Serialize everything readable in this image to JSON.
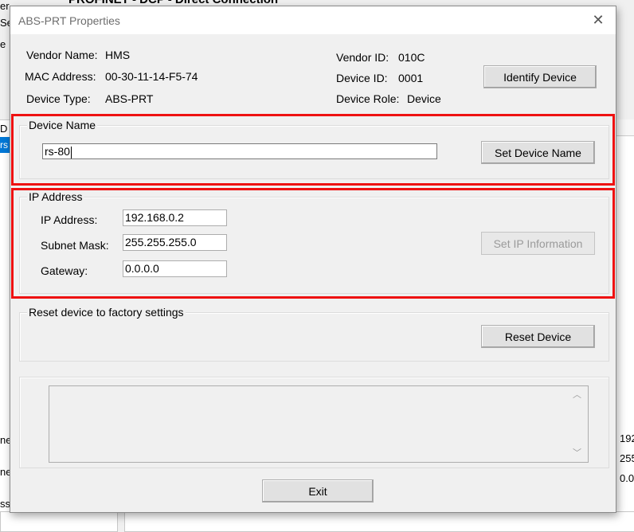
{
  "background": {
    "title_fragment": "PROFINET - DCP - Direct Connection",
    "left_fragments": [
      "er",
      "Se",
      "e",
      "D",
      "rs",
      "ne",
      "ne",
      "ss"
    ],
    "right_fragments": [
      "192",
      "255",
      "0.0"
    ]
  },
  "dialog": {
    "title": "ABS-PRT Properties",
    "close_glyph": "✕",
    "info": {
      "vendor_name_label": "Vendor Name:",
      "vendor_name": "HMS",
      "mac_label": "MAC Address:",
      "mac": "00-30-11-14-F5-74",
      "device_type_label": "Device Type:",
      "device_type": "ABS-PRT",
      "vendor_id_label": "Vendor ID:",
      "vendor_id": "010C",
      "device_id_label": "Device ID:",
      "device_id": "0001",
      "device_role_label": "Device Role:",
      "device_role": "Device"
    },
    "identify_button": "Identify Device",
    "device_name_group": {
      "label": "Device Name",
      "value": "rs-80",
      "button": "Set Device Name"
    },
    "ip_group": {
      "label": "IP Address",
      "ip_label": "IP Address:",
      "ip_value": "192.168.0.2",
      "subnet_label": "Subnet Mask:",
      "subnet_value": "255.255.255.0",
      "gateway_label": "Gateway:",
      "gateway_value": "0.0.0.0",
      "button": "Set IP Information"
    },
    "reset_group": {
      "label": "Reset device to factory settings",
      "button": "Reset Device"
    },
    "exit_button": "Exit"
  },
  "colors": {
    "highlight_box": "#ee1111",
    "selection": "#0078d7"
  }
}
